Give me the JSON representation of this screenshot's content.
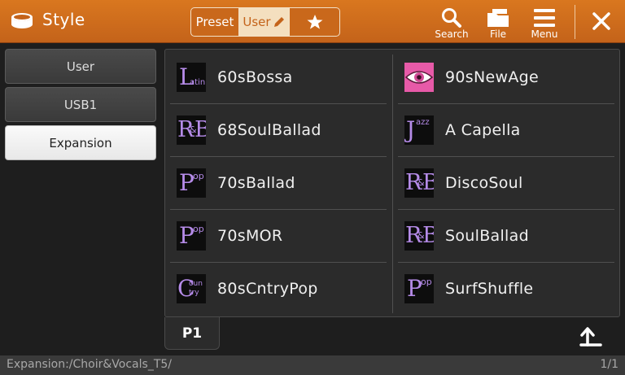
{
  "header": {
    "title": "Style",
    "tabs": {
      "preset": "Preset",
      "user": "User"
    },
    "search_label": "Search",
    "file_label": "File",
    "menu_label": "Menu"
  },
  "sidebar": {
    "items": [
      {
        "label": "User",
        "active": false
      },
      {
        "label": "USB1",
        "active": false
      },
      {
        "label": "Expansion",
        "active": true
      }
    ]
  },
  "styles": [
    {
      "name": "60sBossa",
      "category_icon": "latin-badge",
      "icon_text": "Latin"
    },
    {
      "name": "90sNewAge",
      "category_icon": "eye-badge"
    },
    {
      "name": "68SoulBallad",
      "category_icon": "rnb-badge",
      "icon_text": "R&B"
    },
    {
      "name": "A Capella",
      "category_icon": "jazz-badge",
      "icon_text": "Jazz"
    },
    {
      "name": "70sBallad",
      "category_icon": "pop-badge",
      "icon_text": "Pop"
    },
    {
      "name": "DiscoSoul",
      "category_icon": "rnb-badge",
      "icon_text": "R&B"
    },
    {
      "name": "70sMOR",
      "category_icon": "pop-badge",
      "icon_text": "Pop"
    },
    {
      "name": "SoulBallad",
      "category_icon": "rnb-badge",
      "icon_text": "R&B"
    },
    {
      "name": "80sCntryPop",
      "category_icon": "country-badge",
      "icon_text": "Country"
    },
    {
      "name": "SurfShuffle",
      "category_icon": "pop-badge",
      "icon_text": "Pop"
    }
  ],
  "page_tab": "P1",
  "status": {
    "path": "Expansion:/Choir&Vocals_T5/",
    "pages": "1/1"
  },
  "colors": {
    "header": "#c4631a",
    "badge_text": "#b58be8",
    "selected": "#f4dfbf"
  }
}
